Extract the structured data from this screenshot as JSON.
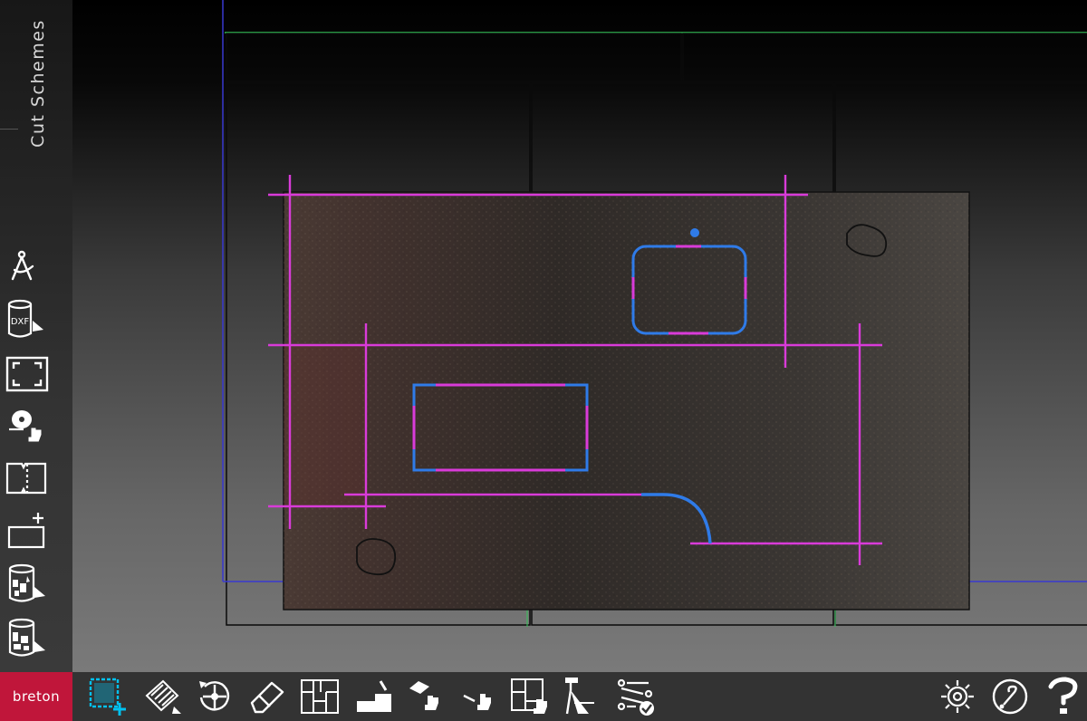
{
  "app": {
    "brand": "breton"
  },
  "sidebar": {
    "tab_label": "Cut Schemes",
    "tools": [
      {
        "name": "compass-tool",
        "icon": "compass-icon"
      },
      {
        "name": "import-dxf",
        "icon": "dxf-file-icon",
        "label": "DXF"
      },
      {
        "name": "frame-select",
        "icon": "frame-corners-icon"
      },
      {
        "name": "disc-select",
        "icon": "saw-disc-hand-icon"
      },
      {
        "name": "cut-slab",
        "icon": "slab-cut-icon"
      },
      {
        "name": "add-rectangle",
        "icon": "add-rectangle-icon"
      },
      {
        "name": "pieces-bin-1",
        "icon": "pieces-bin-icon"
      },
      {
        "name": "pieces-bin-2",
        "icon": "pieces-bin-icon"
      }
    ]
  },
  "toolbar": {
    "active_tool": "new-selection",
    "tools": [
      {
        "name": "new-selection",
        "icon": "select-add-icon",
        "active": true
      },
      {
        "name": "slab-edit",
        "icon": "slab-edit-icon"
      },
      {
        "name": "rotate-piece",
        "icon": "rotate-icon"
      },
      {
        "name": "eraser",
        "icon": "eraser-icon"
      },
      {
        "name": "nesting",
        "icon": "nesting-icon"
      },
      {
        "name": "tool-profile",
        "icon": "tool-profile-icon"
      },
      {
        "name": "move-piece",
        "icon": "move-hand-icon"
      },
      {
        "name": "point-select",
        "icon": "pointer-hand-icon"
      },
      {
        "name": "layout-select",
        "icon": "layout-hand-icon"
      },
      {
        "name": "spray-tool",
        "icon": "spray-icon"
      },
      {
        "name": "path-check",
        "icon": "path-check-icon"
      }
    ],
    "right_tools": [
      {
        "name": "settings",
        "icon": "gear-icon"
      },
      {
        "name": "help",
        "icon": "help-icon"
      },
      {
        "name": "manual",
        "icon": "question-icon"
      }
    ]
  },
  "colors": {
    "accent": "#c0163a",
    "cut_line": "#d93bd9",
    "shape_line": "#2f7be8",
    "active_tool": "#00c2f0",
    "origin_line": "#34c759"
  }
}
